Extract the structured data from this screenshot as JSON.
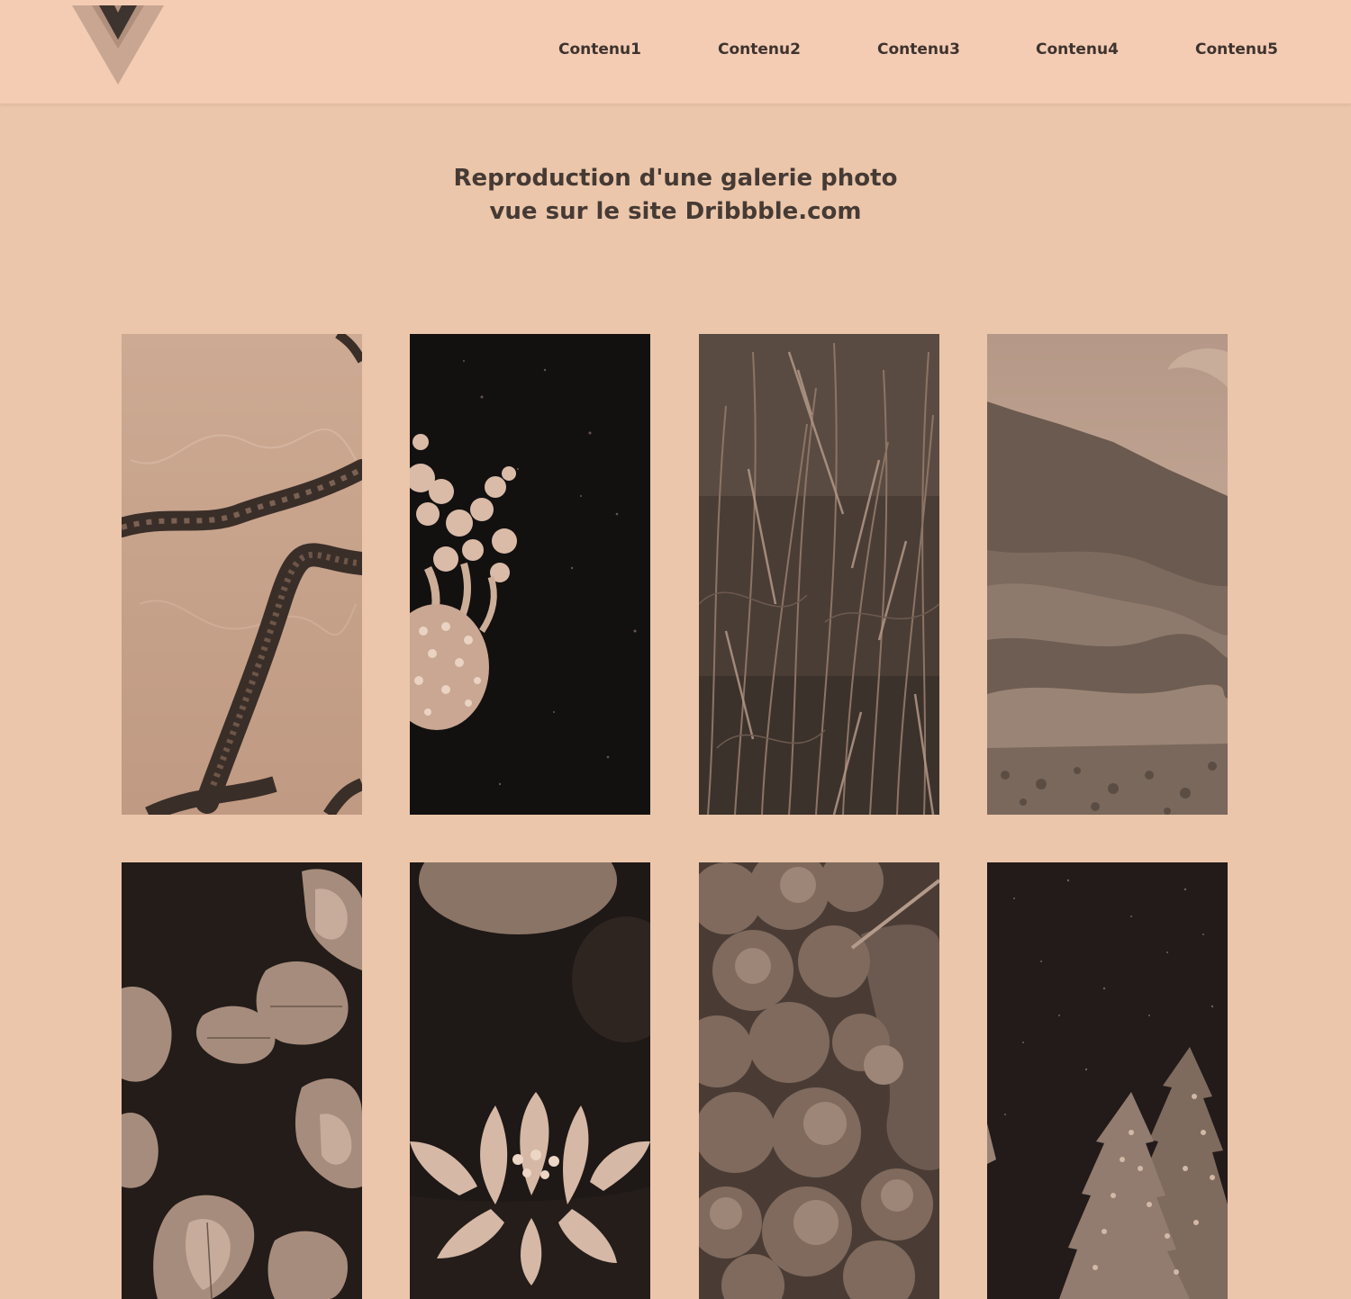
{
  "colors": {
    "header_background": "#f4ccb4",
    "page_background": "#ebc6aa",
    "text": "#3b302c"
  },
  "header": {
    "logo_icon": "v-triangle-logo-icon",
    "nav": [
      {
        "label": "Contenu1"
      },
      {
        "label": "Contenu2"
      },
      {
        "label": "Contenu3"
      },
      {
        "label": "Contenu4"
      },
      {
        "label": "Contenu5"
      }
    ]
  },
  "main": {
    "title_line1": "Reproduction d'une galerie photo",
    "title_line2": "vue sur le site Dribbble.com"
  },
  "gallery": {
    "photos": [
      {
        "subject": "branches-on-ice-photo"
      },
      {
        "subject": "jellyfish-photo"
      },
      {
        "subject": "tall-grass-photo"
      },
      {
        "subject": "mountain-landscape-photo"
      },
      {
        "subject": "oak-leaves-photo"
      },
      {
        "subject": "water-lily-photo"
      },
      {
        "subject": "aerial-forest-photo"
      },
      {
        "subject": "pine-trees-night-sky-photo"
      }
    ]
  }
}
